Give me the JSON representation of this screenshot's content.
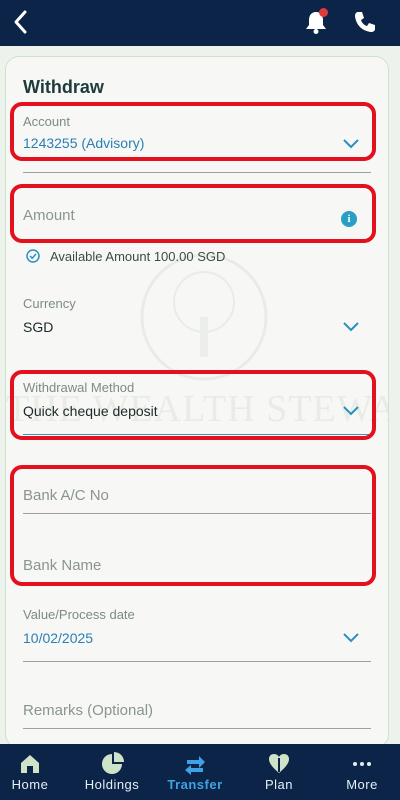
{
  "header": {
    "back_icon": "chevron-left-icon",
    "bell_icon": "bell-icon",
    "phone_icon": "phone-icon"
  },
  "card": {
    "title": "Withdraw"
  },
  "watermark": {
    "text": "THE WEALTH STEWARDS"
  },
  "form": {
    "account": {
      "label": "Account",
      "value": "1243255 (Advisory)"
    },
    "amount": {
      "placeholder": "Amount"
    },
    "available": {
      "text": "Available Amount 100.00 SGD"
    },
    "currency": {
      "label": "Currency",
      "value": "SGD"
    },
    "withdrawal_method": {
      "label": "Withdrawal Method",
      "value": "Quick cheque deposit"
    },
    "bank_ac_no": {
      "placeholder": "Bank A/C No"
    },
    "bank_name": {
      "placeholder": "Bank Name"
    },
    "value_date": {
      "label": "Value/Process date",
      "value": "10/02/2025"
    },
    "remarks": {
      "placeholder": "Remarks (Optional)"
    }
  },
  "nav": {
    "items": [
      {
        "label": "Home",
        "icon": "home-icon"
      },
      {
        "label": "Holdings",
        "icon": "pie-chart-icon"
      },
      {
        "label": "Transfer",
        "icon": "transfer-icon",
        "active": true
      },
      {
        "label": "Plan",
        "icon": "plan-icon"
      },
      {
        "label": "More",
        "icon": "more-icon"
      }
    ]
  },
  "colors": {
    "primary": "#0b2447",
    "accent": "#3fa2e6",
    "highlight": "#e3101d"
  }
}
